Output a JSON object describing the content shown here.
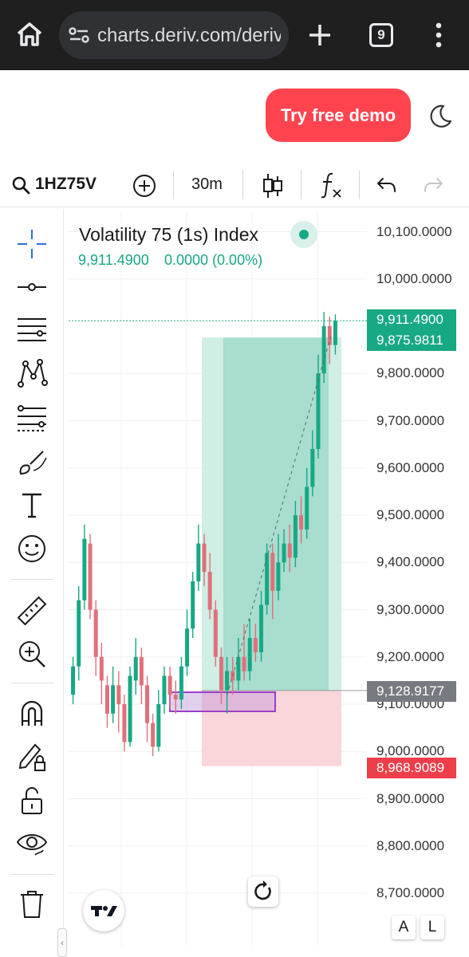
{
  "browser": {
    "url": "charts.deriv.com/deriv",
    "tab_count": "9",
    "icons": [
      "home-icon",
      "site-settings-icon",
      "plus-icon",
      "tabs-icon",
      "more-icon"
    ]
  },
  "header": {
    "demo_button": "Try free demo",
    "accent": "#ff444f"
  },
  "toolbar": {
    "symbol": "1HZ75V",
    "interval": "30m"
  },
  "sidebar": {
    "tools": [
      "crosshair",
      "horizontal-line",
      "parallel-lines",
      "pattern",
      "fibonacci",
      "brush",
      "text",
      "emoji",
      "ruler",
      "zoom-in",
      "magnet",
      "lock-drawing",
      "unlock",
      "visibility",
      "trash"
    ]
  },
  "chart": {
    "title": "Volatility 75 (1s) Index",
    "quote": "9,911.4900",
    "change": "0.0000 (0.00%)",
    "up_color": "#17a884",
    "down_color": "#e0707a",
    "price_tags": {
      "last": "9,911.4900",
      "target": "9,875.9811",
      "entry": "9,128.9177",
      "stop": "8,968.9089"
    },
    "y_ticks": [
      "10,100.0000",
      "10,000.0000",
      "9,800.0000",
      "9,700.0000",
      "9,600.0000",
      "9,500.0000",
      "9,400.0000",
      "9,300.0000",
      "9,200.0000",
      "9,100.0000",
      "9,000.0000",
      "8,900.0000",
      "8,800.0000",
      "8,700.0000"
    ],
    "scale_buttons": {
      "auto": "A",
      "log": "L"
    }
  },
  "chart_data": {
    "type": "candlestick",
    "ylim": [
      8650,
      10150
    ],
    "last_price": 9911.49,
    "long_position": {
      "entry": 9128.9177,
      "target": 9875.9811,
      "stop": 8968.9089
    },
    "series": [
      {
        "o": 9120,
        "c": 9180,
        "h": 9200,
        "l": 9100
      },
      {
        "o": 9180,
        "c": 9320,
        "h": 9350,
        "l": 9150
      },
      {
        "o": 9320,
        "c": 9450,
        "h": 9480,
        "l": 9300
      },
      {
        "o": 9440,
        "c": 9300,
        "h": 9460,
        "l": 9280
      },
      {
        "o": 9300,
        "c": 9200,
        "h": 9320,
        "l": 9160
      },
      {
        "o": 9200,
        "c": 9150,
        "h": 9230,
        "l": 9100
      },
      {
        "o": 9140,
        "c": 9080,
        "h": 9160,
        "l": 9050
      },
      {
        "o": 9080,
        "c": 9140,
        "h": 9180,
        "l": 9060
      },
      {
        "o": 9140,
        "c": 9100,
        "h": 9170,
        "l": 9040
      },
      {
        "o": 9100,
        "c": 9020,
        "h": 9120,
        "l": 9000
      },
      {
        "o": 9020,
        "c": 9160,
        "h": 9180,
        "l": 9010
      },
      {
        "o": 9150,
        "c": 9200,
        "h": 9240,
        "l": 9120
      },
      {
        "o": 9200,
        "c": 9140,
        "h": 9220,
        "l": 9100
      },
      {
        "o": 9140,
        "c": 9060,
        "h": 9160,
        "l": 9020
      },
      {
        "o": 9060,
        "c": 9010,
        "h": 9080,
        "l": 8990
      },
      {
        "o": 9010,
        "c": 9100,
        "h": 9130,
        "l": 9000
      },
      {
        "o": 9100,
        "c": 9160,
        "h": 9180,
        "l": 9080
      },
      {
        "o": 9160,
        "c": 9120,
        "h": 9180,
        "l": 9090
      },
      {
        "o": 9120,
        "c": 9110,
        "h": 9150,
        "l": 9080
      },
      {
        "o": 9110,
        "c": 9180,
        "h": 9200,
        "l": 9090
      },
      {
        "o": 9180,
        "c": 9260,
        "h": 9300,
        "l": 9160
      },
      {
        "o": 9260,
        "c": 9360,
        "h": 9380,
        "l": 9240
      },
      {
        "o": 9360,
        "c": 9440,
        "h": 9480,
        "l": 9340
      },
      {
        "o": 9440,
        "c": 9380,
        "h": 9460,
        "l": 9350
      },
      {
        "o": 9380,
        "c": 9300,
        "h": 9420,
        "l": 9280
      },
      {
        "o": 9300,
        "c": 9200,
        "h": 9320,
        "l": 9180
      },
      {
        "o": 9200,
        "c": 9130,
        "h": 9220,
        "l": 9100
      },
      {
        "o": 9130,
        "c": 9170,
        "h": 9200,
        "l": 9080
      },
      {
        "o": 9170,
        "c": 9150,
        "h": 9200,
        "l": 9120
      },
      {
        "o": 9150,
        "c": 9200,
        "h": 9240,
        "l": 9130
      },
      {
        "o": 9200,
        "c": 9170,
        "h": 9270,
        "l": 9150
      },
      {
        "o": 9170,
        "c": 9240,
        "h": 9280,
        "l": 9150
      },
      {
        "o": 9240,
        "c": 9210,
        "h": 9270,
        "l": 9190
      },
      {
        "o": 9210,
        "c": 9310,
        "h": 9340,
        "l": 9190
      },
      {
        "o": 9310,
        "c": 9420,
        "h": 9440,
        "l": 9290
      },
      {
        "o": 9420,
        "c": 9340,
        "h": 9440,
        "l": 9280
      },
      {
        "o": 9340,
        "c": 9400,
        "h": 9460,
        "l": 9320
      },
      {
        "o": 9400,
        "c": 9440,
        "h": 9470,
        "l": 9380
      },
      {
        "o": 9440,
        "c": 9410,
        "h": 9480,
        "l": 9380
      },
      {
        "o": 9410,
        "c": 9500,
        "h": 9530,
        "l": 9390
      },
      {
        "o": 9500,
        "c": 9470,
        "h": 9540,
        "l": 9440
      },
      {
        "o": 9470,
        "c": 9560,
        "h": 9600,
        "l": 9450
      },
      {
        "o": 9560,
        "c": 9640,
        "h": 9680,
        "l": 9540
      },
      {
        "o": 9640,
        "c": 9800,
        "h": 9840,
        "l": 9620
      },
      {
        "o": 9800,
        "c": 9900,
        "h": 9930,
        "l": 9780
      },
      {
        "o": 9900,
        "c": 9860,
        "h": 9920,
        "l": 9820
      },
      {
        "o": 9860,
        "c": 9911,
        "h": 9925,
        "l": 9840
      }
    ]
  }
}
